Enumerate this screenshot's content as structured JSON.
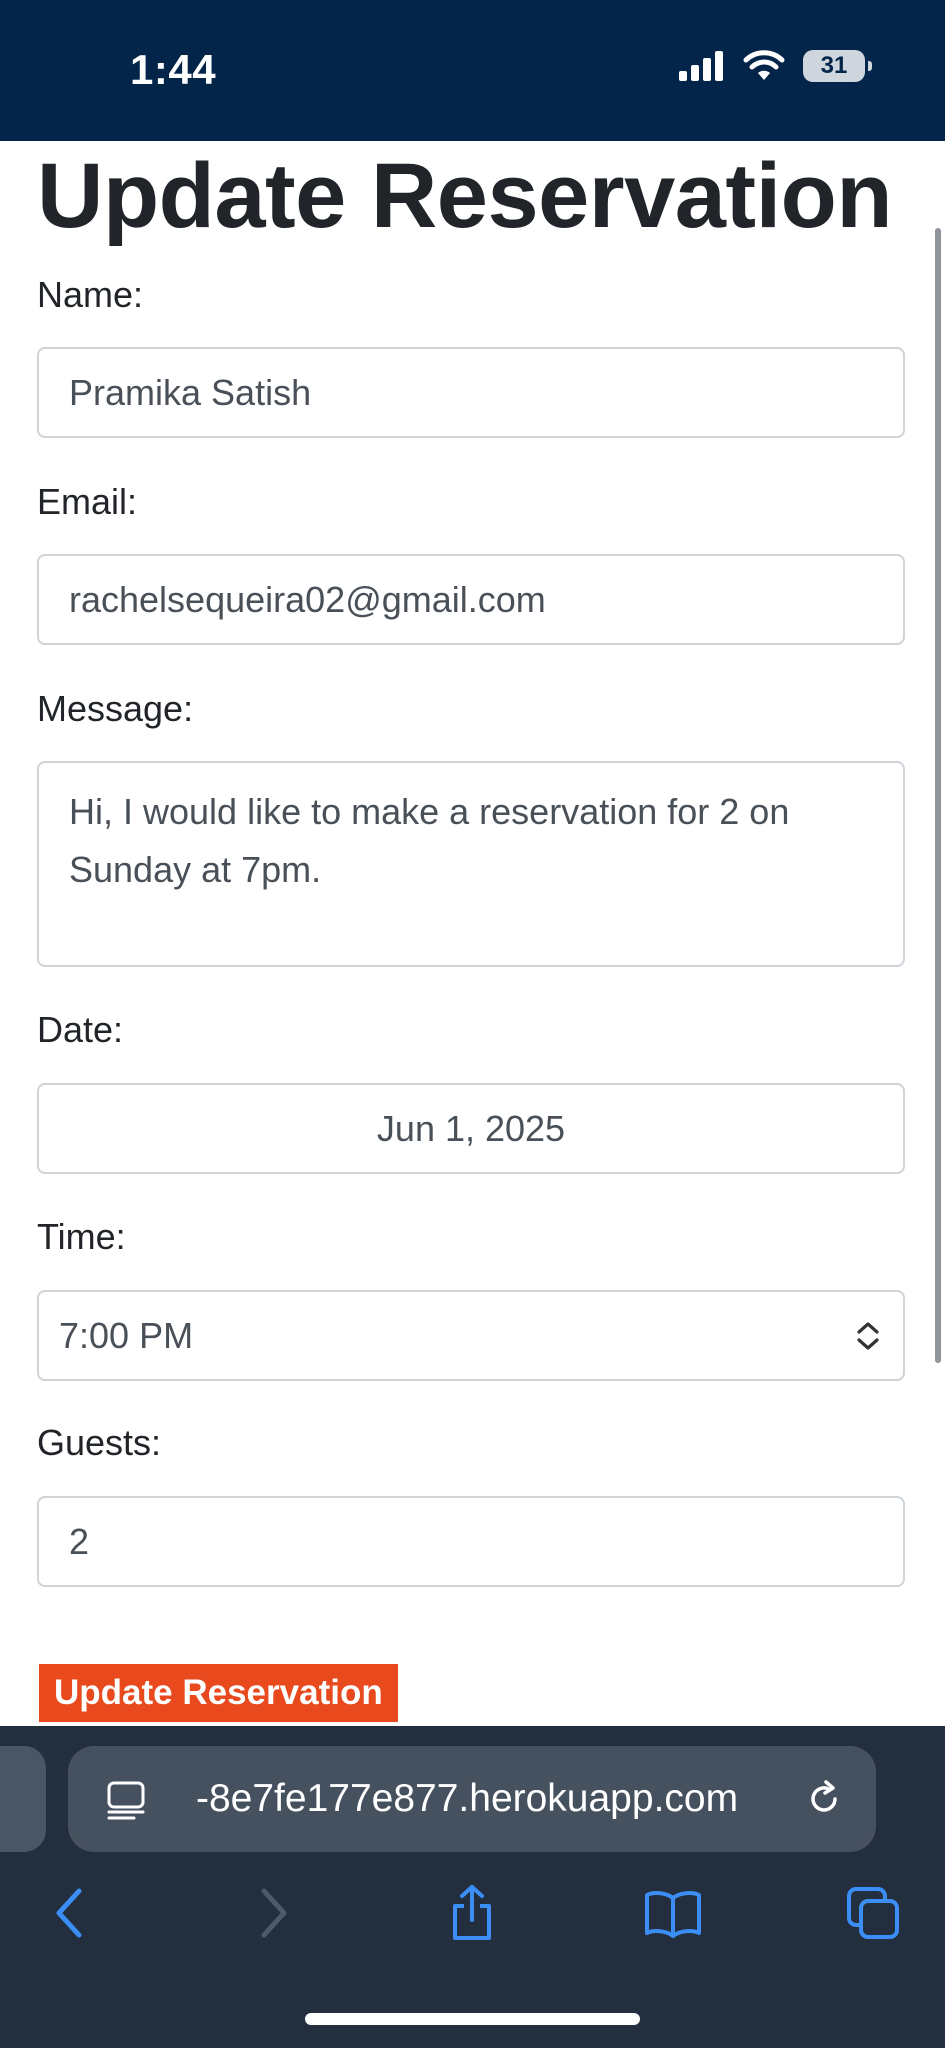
{
  "status_bar": {
    "time": "1:44",
    "battery": "31"
  },
  "form": {
    "title": "Update Reservation",
    "name": {
      "label": "Name:",
      "value": "Pramika Satish"
    },
    "email": {
      "label": "Email:",
      "value": "rachelsequeira02@gmail.com"
    },
    "message": {
      "label": "Message:",
      "value": "Hi, I would like to make a reservation for 2 on Sunday at 7pm."
    },
    "date": {
      "label": "Date:",
      "value": "Jun 1, 2025"
    },
    "time": {
      "label": "Time:",
      "value": "7:00 PM"
    },
    "guests": {
      "label": "Guests:",
      "value": "2"
    },
    "submit_label": "Update Reservation"
  },
  "browser": {
    "url": "-8e7fe177e877.herokuapp.com",
    "icons": [
      "reader-icon",
      "reload-icon",
      "back-icon",
      "forward-icon",
      "share-icon",
      "bookmarks-icon",
      "tabs-icon"
    ]
  },
  "colors": {
    "status_bar_bg": "#03254a",
    "button_bg": "#e8491d",
    "browser_bg": "#232f3f",
    "link_blue": "#3a8ef6"
  }
}
